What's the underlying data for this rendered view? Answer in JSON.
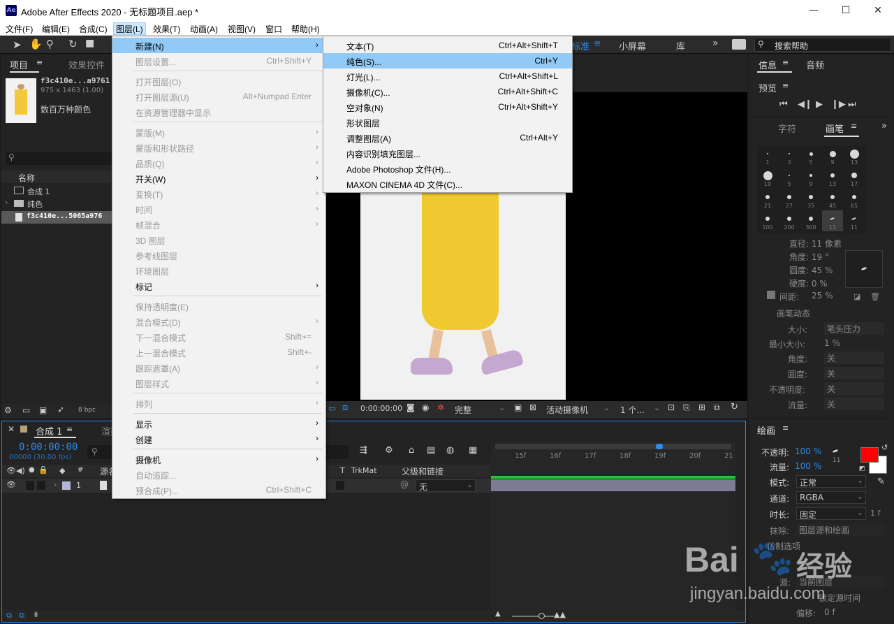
{
  "titlebar": {
    "logo": "Ae",
    "title": "Adobe After Effects 2020 - 无标题项目.aep *",
    "minimize": "—",
    "maximize": "☐",
    "close": "✕"
  },
  "menubar": [
    "文件(F)",
    "编辑(E)",
    "合成(C)",
    "图层(L)",
    "效果(T)",
    "动画(A)",
    "视图(V)",
    "窗口",
    "帮助(H)"
  ],
  "workspace": {
    "standard": "标准",
    "small_screen": "小屏幕",
    "library": "库",
    "more": "»",
    "search_placeholder": "搜索帮助"
  },
  "project_panel": {
    "tab_project": "项目",
    "tab_effects": "效果控件",
    "file_name": "f3c410e...a9761",
    "file_size": "975 x 1463 (1.00)",
    "file_colors": "数百万种颜色",
    "col_name": "名称",
    "rows": [
      "合成 1",
      "纯色",
      "f3c410e...5065a976"
    ],
    "bpc": "8 bpc"
  },
  "layer_menu": {
    "items": [
      {
        "label": "新建(N)",
        "shortcut": "",
        "arrow": true,
        "disabled": false,
        "hl": true
      },
      {
        "label": "图层设置...",
        "shortcut": "Ctrl+Shift+Y",
        "arrow": false,
        "disabled": true
      },
      {
        "sep": true
      },
      {
        "label": "打开图层(O)",
        "shortcut": "",
        "arrow": false,
        "disabled": true
      },
      {
        "label": "打开图层源(U)",
        "shortcut": "Alt+Numpad Enter",
        "arrow": false,
        "disabled": true
      },
      {
        "label": "在资源管理器中显示",
        "shortcut": "",
        "arrow": false,
        "disabled": true
      },
      {
        "sep": true
      },
      {
        "label": "蒙版(M)",
        "shortcut": "",
        "arrow": true,
        "disabled": true
      },
      {
        "label": "蒙版和形状路径",
        "shortcut": "",
        "arrow": true,
        "disabled": true
      },
      {
        "label": "品质(Q)",
        "shortcut": "",
        "arrow": true,
        "disabled": true
      },
      {
        "label": "开关(W)",
        "shortcut": "",
        "arrow": true,
        "disabled": false
      },
      {
        "label": "变换(T)",
        "shortcut": "",
        "arrow": true,
        "disabled": true
      },
      {
        "label": "时间",
        "shortcut": "",
        "arrow": true,
        "disabled": true
      },
      {
        "label": "帧混合",
        "shortcut": "",
        "arrow": true,
        "disabled": true
      },
      {
        "label": "3D 图层",
        "shortcut": "",
        "arrow": false,
        "disabled": true
      },
      {
        "label": "参考线图层",
        "shortcut": "",
        "arrow": false,
        "disabled": true
      },
      {
        "label": "环境图层",
        "shortcut": "",
        "arrow": false,
        "disabled": true
      },
      {
        "label": "标记",
        "shortcut": "",
        "arrow": true,
        "disabled": false
      },
      {
        "sep": true
      },
      {
        "label": "保持透明度(E)",
        "shortcut": "",
        "arrow": false,
        "disabled": true
      },
      {
        "label": "混合模式(D)",
        "shortcut": "",
        "arrow": true,
        "disabled": true
      },
      {
        "label": "下一混合模式",
        "shortcut": "Shift+=",
        "arrow": false,
        "disabled": true
      },
      {
        "label": "上一混合模式",
        "shortcut": "Shift+-",
        "arrow": false,
        "disabled": true
      },
      {
        "label": "跟踪遮罩(A)",
        "shortcut": "",
        "arrow": true,
        "disabled": true
      },
      {
        "label": "图层样式",
        "shortcut": "",
        "arrow": true,
        "disabled": true
      },
      {
        "sep": true
      },
      {
        "label": "排列",
        "shortcut": "",
        "arrow": true,
        "disabled": true
      },
      {
        "sep": true
      },
      {
        "label": "显示",
        "shortcut": "",
        "arrow": true,
        "disabled": false
      },
      {
        "label": "创建",
        "shortcut": "",
        "arrow": true,
        "disabled": false
      },
      {
        "sep": true
      },
      {
        "label": "摄像机",
        "shortcut": "",
        "arrow": true,
        "disabled": false
      },
      {
        "label": "自动追踪...",
        "shortcut": "",
        "arrow": false,
        "disabled": true
      },
      {
        "label": "预合成(P)...",
        "shortcut": "Ctrl+Shift+C",
        "arrow": false,
        "disabled": true
      }
    ]
  },
  "new_submenu": {
    "items": [
      {
        "label": "文本(T)",
        "shortcut": "Ctrl+Alt+Shift+T"
      },
      {
        "label": "纯色(S)...",
        "shortcut": "Ctrl+Y",
        "hl": true
      },
      {
        "label": "灯光(L)...",
        "shortcut": "Ctrl+Alt+Shift+L"
      },
      {
        "label": "摄像机(C)...",
        "shortcut": "Ctrl+Alt+Shift+C"
      },
      {
        "label": "空对象(N)",
        "shortcut": "Ctrl+Alt+Shift+Y"
      },
      {
        "label": "形状图层",
        "shortcut": ""
      },
      {
        "label": "调整图层(A)",
        "shortcut": "Ctrl+Alt+Y"
      },
      {
        "label": "内容识别填充图层...",
        "shortcut": ""
      },
      {
        "label": "Adobe Photoshop 文件(H)...",
        "shortcut": ""
      },
      {
        "label": "MAXON CINEMA 4D 文件(C)...",
        "shortcut": ""
      }
    ]
  },
  "viewer": {
    "timecode": "0:00:00:00",
    "quality": "完整",
    "camera": "活动摄像机",
    "views": "1 个..."
  },
  "info_panel": {
    "tab_info": "信息",
    "tab_audio": "音频",
    "preview": "预览",
    "tab_char": "字符",
    "tab_brush": "画笔"
  },
  "brushes": [
    "1",
    "3",
    "5",
    "9",
    "13",
    "19",
    "5",
    "9",
    "13",
    "17",
    "21",
    "27",
    "35",
    "45",
    "65",
    "100",
    "200",
    "300",
    "11",
    "11"
  ],
  "brush_props": {
    "diameter": "直径: 11 像素",
    "angle": "角度: 19 °",
    "roundness": "圆度: 45 %",
    "hardness": "硬度: 0 %",
    "spacing_label": "间距:",
    "spacing_value": "25 %",
    "dynamics": "画笔动态",
    "size_label": "大小:",
    "size_value": "笔头压力",
    "min_size_label": "最小大小:",
    "min_size_value": "1 %",
    "angle_label": "角度:",
    "angle_value": "关",
    "round_label": "圆度:",
    "round_value": "关",
    "opacity_label": "不透明度:",
    "opacity_value": "关",
    "flow_label": "流量:",
    "flow_value": "关"
  },
  "paint_panel": {
    "title": "绘画",
    "opacity_label": "不透明:",
    "opacity_value": "100 %",
    "flow_label": "流量:",
    "flow_value": "100 %",
    "brush_size": "11",
    "mode_label": "模式:",
    "mode_value": "正常",
    "channel_label": "通道:",
    "channel_value": "RGBA",
    "duration_label": "时长:",
    "duration_value": "固定",
    "erase_label": "抹除:",
    "erase_value": "图层源和绘画",
    "clone_options": "仿制选项",
    "source_label": "源:",
    "source_value": "当前图层",
    "frame": "1 f",
    "lock_time": "锁定源时间",
    "offset_label": "偏移:",
    "offset_value": "0 f",
    "fg_color": "#ff0000",
    "bg_color": "#ffffff"
  },
  "timeline": {
    "tab_comp": "合成 1",
    "tab_render": "渲染队列",
    "timecode": "0:00:00:00",
    "fps": "00000 (30.00 fps)",
    "col_source": "源名称",
    "col_trkmat": "TrkMat",
    "col_parent": "父级和链接",
    "layer_num": "1",
    "parent_value": "无",
    "ruler": [
      "15f",
      "16f",
      "17f",
      "18f",
      "19f",
      "20f",
      "21"
    ]
  },
  "watermark": {
    "brand": "Bai",
    "brand_cn": "经验",
    "url": "jingyan.baidu.com"
  }
}
